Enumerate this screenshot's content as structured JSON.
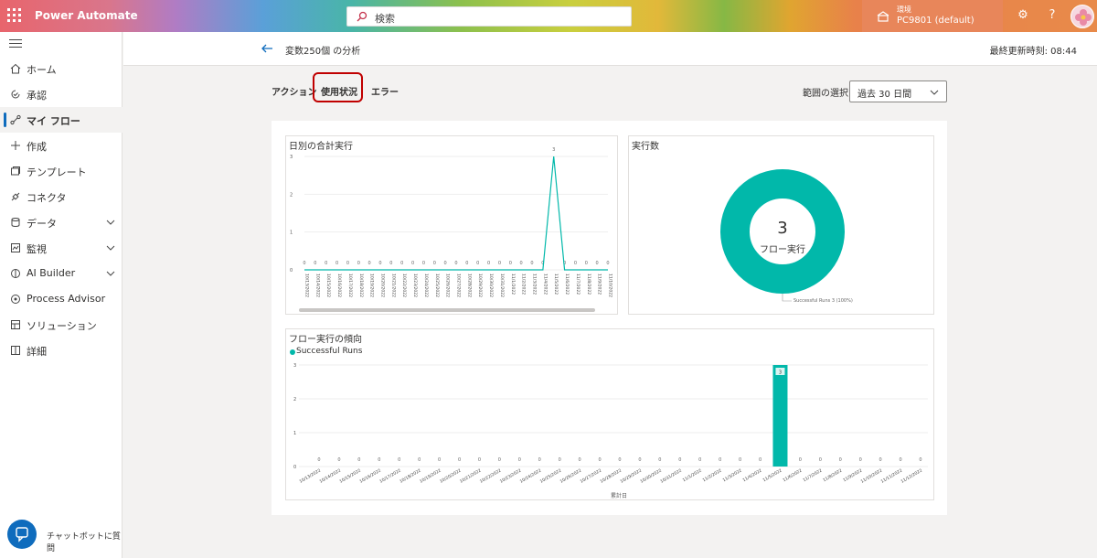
{
  "app": {
    "name": "Power Automate"
  },
  "search": {
    "placeholder": "検索"
  },
  "environment": {
    "label": "環境",
    "name": "PC9801 (default)"
  },
  "sidebar": {
    "items": [
      {
        "label": "ホーム",
        "icon": "home-icon"
      },
      {
        "label": "承認",
        "icon": "approvals-icon"
      },
      {
        "label": "マイ フロー",
        "icon": "flow-icon",
        "active": true
      },
      {
        "label": "作成",
        "icon": "plus-icon"
      },
      {
        "label": "テンプレート",
        "icon": "template-icon"
      },
      {
        "label": "コネクタ",
        "icon": "connector-icon"
      },
      {
        "label": "データ",
        "icon": "data-icon",
        "expandable": true
      },
      {
        "label": "監視",
        "icon": "monitor-icon",
        "expandable": true
      },
      {
        "label": "AI Builder",
        "icon": "ai-builder-icon",
        "expandable": true
      },
      {
        "label": "Process Advisor",
        "icon": "process-advisor-icon"
      },
      {
        "label": "ソリューション",
        "icon": "solutions-icon"
      },
      {
        "label": "詳細",
        "icon": "book-icon"
      }
    ],
    "chatbot": "チャットボットに質問"
  },
  "header": {
    "title": "変数250個 の分析",
    "updated": "最終更新時刻: 08:44"
  },
  "tabs": [
    "アクション",
    "使用状況",
    "エラー"
  ],
  "range": {
    "label": "範囲の選択",
    "value": "過去 30 日間"
  },
  "colors": {
    "accent": "#01b8aa",
    "highlight": "#c00000",
    "brand": "#0f6cbd"
  },
  "cards": {
    "daily": {
      "title": "日別の合計実行"
    },
    "count": {
      "title": "実行数",
      "value": "3",
      "sub": "フロー実行",
      "legend": "Successful Runs 3 (100%)"
    },
    "trend": {
      "title": "フロー実行の傾向",
      "xlabel": "累計日"
    }
  },
  "chart_data": [
    {
      "type": "line",
      "title": "日別の合計実行",
      "x": [
        "10/13/2022",
        "10/14/2022",
        "10/15/2022",
        "10/16/2022",
        "10/17/2022",
        "10/18/2022",
        "10/19/2022",
        "10/20/2022",
        "10/21/2022",
        "10/22/2022",
        "10/23/2022",
        "10/24/2022",
        "10/25/2022",
        "10/26/2022",
        "10/27/2022",
        "10/28/2022",
        "10/29/2022",
        "10/30/2022",
        "10/31/2022",
        "11/1/2022",
        "11/2/2022",
        "11/3/2022",
        "11/4/2022",
        "11/5/2022",
        "11/6/2022",
        "11/7/2022",
        "11/8/2022",
        "11/9/2022",
        "11/10/2022"
      ],
      "values": [
        0,
        0,
        0,
        0,
        0,
        0,
        0,
        0,
        0,
        0,
        0,
        0,
        0,
        0,
        0,
        0,
        0,
        0,
        0,
        0,
        0,
        0,
        0,
        3,
        0,
        0,
        0,
        0,
        0
      ],
      "yticks": [
        0,
        1,
        2,
        3
      ],
      "ylim": [
        0,
        3
      ]
    },
    {
      "type": "pie",
      "title": "実行数",
      "slices": [
        {
          "name": "Successful Runs",
          "value": 3,
          "percent": "100%"
        }
      ]
    },
    {
      "type": "bar",
      "title": "フロー実行の傾向",
      "xlabel": "累計日",
      "series": [
        {
          "name": "Successful Runs",
          "values": [
            0,
            0,
            0,
            0,
            0,
            0,
            0,
            0,
            0,
            0,
            0,
            0,
            0,
            0,
            0,
            0,
            0,
            0,
            0,
            0,
            0,
            0,
            0,
            3,
            0,
            0,
            0,
            0,
            0,
            0,
            0
          ]
        }
      ],
      "categories": [
        "10/13/2022",
        "10/14/2022",
        "10/15/2022",
        "10/16/2022",
        "10/17/2022",
        "10/18/2022",
        "10/19/2022",
        "10/20/2022",
        "10/21/2022",
        "10/22/2022",
        "10/23/2022",
        "10/24/2022",
        "10/25/2022",
        "10/26/2022",
        "10/27/2022",
        "10/28/2022",
        "10/29/2022",
        "10/30/2022",
        "10/31/2022",
        "11/1/2022",
        "11/2/2022",
        "11/3/2022",
        "11/4/2022",
        "11/5/2022",
        "11/6/2022",
        "11/7/2022",
        "11/8/2022",
        "11/9/2022",
        "11/10/2022",
        "11/11/2022",
        "11/12/2022"
      ],
      "yticks": [
        0,
        1,
        2,
        3
      ],
      "ylim": [
        0,
        3
      ]
    }
  ]
}
